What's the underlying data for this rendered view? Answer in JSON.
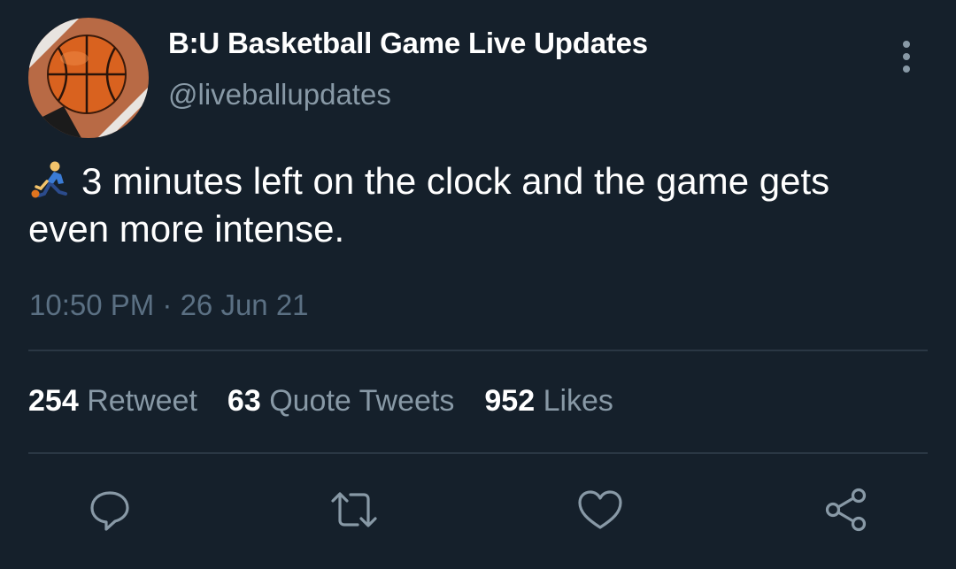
{
  "tweet": {
    "author": {
      "display_name": "B:U Basketball Game Live Updates",
      "handle": "@liveballupdates",
      "avatar_icon": "basketball-icon"
    },
    "text": "3 minutes left on the clock and the game gets even more intense.",
    "leading_emoji_icon": "person-bouncing-ball-icon",
    "timestamp": "10:50 PM · 26 Jun 21",
    "stats": {
      "retweets_count": "254",
      "retweets_label": "Retweet",
      "quotes_count": "63",
      "quotes_label": "Quote Tweets",
      "likes_count": "952",
      "likes_label": "Likes"
    },
    "actions": [
      "reply-icon",
      "retweet-icon",
      "like-icon",
      "share-icon"
    ],
    "more_icon": "more-vertical-icon"
  },
  "theme": {
    "background": "#15202b",
    "primary_text": "#ffffff",
    "secondary_text": "#8899a6",
    "divider": "#2a3744",
    "icon": "#8899a6"
  }
}
